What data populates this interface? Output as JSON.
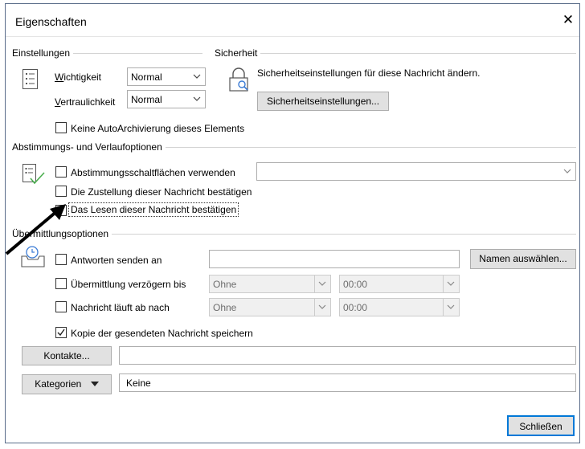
{
  "window": {
    "title": "Eigenschaften",
    "close": "✕"
  },
  "settings": {
    "group": "Einstellungen",
    "importance_label": "Wichtigkeit",
    "importance_value": "Normal",
    "sensitivity_label": "Vertraulichkeit",
    "sensitivity_value": "Normal",
    "no_autoarchive": "Keine AutoArchivierung dieses Elements",
    "no_autoarchive_checked": false
  },
  "security": {
    "group": "Sicherheit",
    "text": "Sicherheitseinstellungen für diese Nachricht ändern.",
    "button": "Sicherheitseinstellungen..."
  },
  "voting": {
    "group": "Abstimmungs- und Verlaufoptionen",
    "use_voting": "Abstimmungsschaltflächen verwenden",
    "use_voting_value": "",
    "delivery_receipt": "Die Zustellung dieser Nachricht bestätigen",
    "read_receipt": "Das Lesen dieser Nachricht bestätigen",
    "read_receipt_checked": true
  },
  "delivery": {
    "group": "Übermittlungsoptionen",
    "replies_to": "Antworten senden an",
    "select_names": "Namen auswählen...",
    "delay": "Übermittlung verzögern bis",
    "delay_date": "Ohne",
    "delay_time": "00:00",
    "expires": "Nachricht läuft ab nach",
    "expires_date": "Ohne",
    "expires_time": "00:00",
    "save_copy": "Kopie der gesendeten Nachricht speichern",
    "save_copy_checked": true
  },
  "contacts": {
    "button": "Kontakte...",
    "value": ""
  },
  "categories": {
    "button": "Kategorien",
    "value": "Keine"
  },
  "footer": {
    "close_button": "Schließen"
  }
}
